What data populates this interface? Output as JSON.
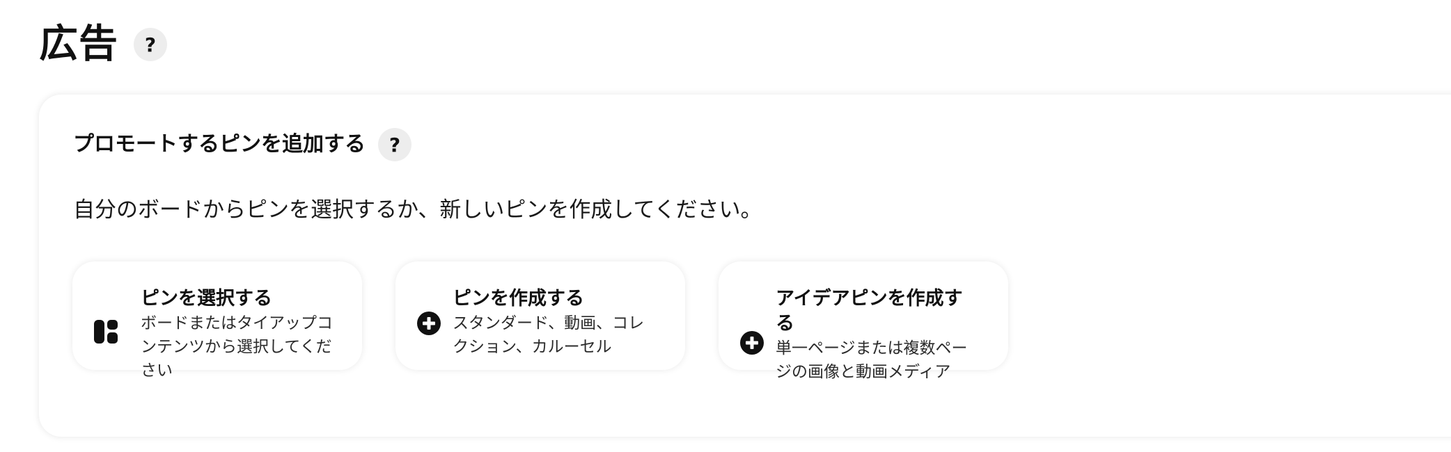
{
  "page": {
    "title": "広告",
    "help_label": "?"
  },
  "promote": {
    "title": "プロモートするピンを追加する",
    "help_label": "?",
    "description": "自分のボードからピンを選択するか、新しいピンを作成してください。",
    "options": [
      {
        "icon": "board-icon",
        "title": "ピンを選択する",
        "subtitle_lines": [
          "ボードまたはタイアップコ",
          "ンテンツから選択してくだ",
          "さい"
        ]
      },
      {
        "icon": "plus-circle-icon",
        "title": "ピンを作成する",
        "subtitle_lines": [
          "スタンダード、動画、コレ",
          "クション、カルーセル"
        ]
      },
      {
        "icon": "plus-circle-icon",
        "title_lines": [
          "アイデアピンを作成す",
          "る"
        ],
        "subtitle_lines": [
          "単一ページまたは複数ペー",
          "ジの画像と動画メディア"
        ]
      }
    ]
  }
}
